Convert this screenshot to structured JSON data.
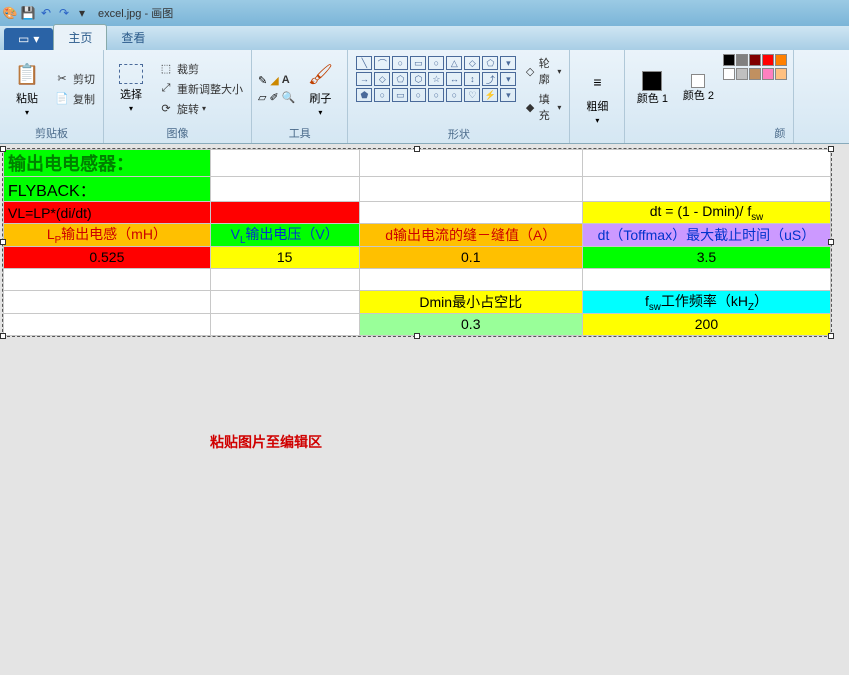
{
  "title": "excel.jpg - 画图",
  "tabs": {
    "file": "",
    "home": "主页",
    "view": "查看"
  },
  "groups": {
    "clipboard": {
      "label": "剪贴板",
      "paste": "粘贴",
      "cut": "剪切",
      "copy": "复制"
    },
    "image": {
      "label": "图像",
      "select": "选择",
      "crop": "裁剪",
      "resize": "重新调整大小",
      "rotate": "旋转"
    },
    "tools": {
      "label": "工具",
      "brush": "刷子"
    },
    "shapes": {
      "label": "形状",
      "outline": "轮廓",
      "fill": "填充"
    },
    "size": {
      "label": "粗细"
    },
    "colors": {
      "label": "颜色",
      "c1": "颜色 1",
      "c2": "颜色 2"
    }
  },
  "sheet": {
    "r1c1": "输出电电感器：",
    "r2c1": "FLYBACK：",
    "r3c1": "VL=LP*(di/dt)",
    "r3c4": "dt = (1 - Dmin)/ f",
    "r3c4_sub": "sw",
    "r4c1_a": "L",
    "r4c1_sub": "P",
    "r4c1_b": "输出电感（mH）",
    "r4c2_a": "V",
    "r4c2_sub": "L",
    "r4c2_b": "输出电压（V）",
    "r4c3": "d输出电流的缝－缝值（A）",
    "r4c4": "dt（Toffmax）最大截止时间（uS）",
    "r5c1": "0.525",
    "r5c2": "15",
    "r5c3": "0.1",
    "r5c4": "3.5",
    "r7c3": "Dmin最小占空比",
    "r7c4_a": "f",
    "r7c4_sub": "sw",
    "r7c4_b": "工作频率（kH",
    "r7c4_sub2": "Z",
    "r7c4_c": "）",
    "r8c3": "0.3",
    "r8c4": "200"
  },
  "hint": "粘贴图片至编辑区",
  "palette": {
    "row1": [
      "#000000",
      "#808080",
      "#800000",
      "#ff0000",
      "#ff8000"
    ],
    "row2": [
      "#ffffff",
      "#c0c0c0",
      "#c09060",
      "#ff80c0",
      "#ffc080"
    ]
  }
}
